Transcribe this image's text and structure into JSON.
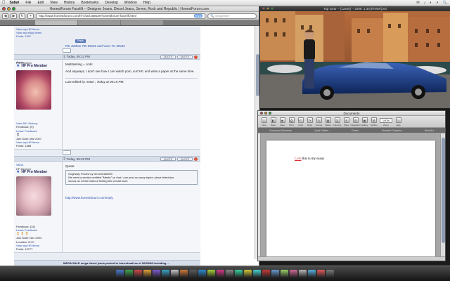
{
  "menubar": {
    "app": "Safari",
    "items": [
      "File",
      "Edit",
      "View",
      "History",
      "Bookmarks",
      "Develop",
      "Window",
      "Help"
    ],
    "right": [
      "✉",
      "♪",
      "◐",
      "⚡",
      "🔍"
    ]
  },
  "browser": {
    "title": "HonestForum Facelift -- Designer Jeans, Diesel Jeans, Seven, Rock and Republic | HonestForum.com",
    "url": "http://www.honestforum.com/hf-chat/168539-honestforum-facelift.html",
    "rss": "RSS",
    "search_placeholder": "Sequester",
    "back_icon": "◀",
    "fwd_icon": "▶",
    "reload_icon": "↻",
    "add_icon": "+"
  },
  "forum": {
    "top_links": [
      "View my HR Items",
      "View my eBay Items",
      "Posts: 1997"
    ],
    "thanks_prefix": "FB:",
    "thanks_text": "Zathan 7ID 39x32 and Vixer 7U 39x32",
    "edit_btn": "QUOTE",
    "quote_btn": "QUOTE",
    "post1": {
      "username": "Anton",
      "date": "Today, 05:12 PM",
      "title": "Pro Member",
      "rank": "HF Pro Member",
      "lines": [
        "Multitasking = Lmk!",
        "And anyways, I don't see how I can watch porn, surf HF, and write a paper at the same time."
      ],
      "edited": "Last edited by Anton ; Today at 05:15 PM.",
      "info": [
        "View 501 History:",
        "Feedback: (9)",
        "Leave Feedback",
        "Join Date: Mar 2007",
        "View my HR Items",
        "Posts: 1388"
      ]
    },
    "post2": {
      "username": "SM14",
      "date": "Today, 05:15 PM",
      "title": "HF Member",
      "rank": "HF Pro Member",
      "quote_label": "Quote:",
      "quote_lines": [
        "Originally Posted by SevenKid0006",
        "We need a section entitled \"Media\" so that I can post as many topics about television",
        "shows as I'd like without feeling like a total loser."
      ],
      "link": "http://www.honestforum.com/reply",
      "info": [
        "Feedback: (34)",
        "Leave Feedback",
        "Join Date: Nov 2004",
        "Location: NYC",
        "View my HR Items",
        "Posts: 13777"
      ]
    },
    "bottom_text": "MEGA SALE mega diesel jeans posted to honestmall as of 06/28/08 including ...",
    "tag": "Reply"
  },
  "photo_window": {
    "title": "Top Gear -- [12x05] -- 2008 .1.30.[RiVER].avi"
  },
  "document": {
    "title": "Document4",
    "toolbar": [
      "New",
      "Open",
      "Save",
      "Print",
      "Undo",
      "Redo",
      "Format",
      "Tables",
      "Columns",
      "Show",
      "Navigation",
      "Gallery",
      "Toolbox",
      "Zoom",
      "Help"
    ],
    "zoom": "100%",
    "ribbon": [
      "Document Elements",
      "Quick Tables",
      "Charts",
      "SmartArt Graphics",
      "WordArt"
    ],
    "text_first": "Lolo",
    "text_rest": " this is my essay"
  },
  "colors": {
    "accent": "#2a4fae",
    "forum_bg": "#e9edf3"
  }
}
